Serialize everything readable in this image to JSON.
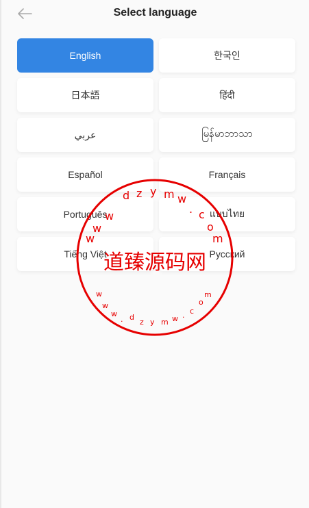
{
  "header": {
    "title": "Select language",
    "back_icon": "arrow-left-icon"
  },
  "languages": [
    {
      "label": "English",
      "selected": true
    },
    {
      "label": "한국인",
      "selected": false
    },
    {
      "label": "日本語",
      "selected": false
    },
    {
      "label": "हिंदी",
      "selected": false
    },
    {
      "label": "عربي",
      "selected": false
    },
    {
      "label": "မြန်မာဘာသာ",
      "selected": false
    },
    {
      "label": "Español",
      "selected": false
    },
    {
      "label": "Français",
      "selected": false
    },
    {
      "label": "Português",
      "selected": false
    },
    {
      "label": "แบบไทย",
      "selected": false
    },
    {
      "label": "Tiếng Việt",
      "selected": false
    },
    {
      "label": "Русский",
      "selected": false
    }
  ],
  "watermark": {
    "name": "道臻源码网",
    "url_text": "www.dzym.com",
    "color": "#e60000"
  },
  "colors": {
    "accent": "#3385e3",
    "background": "#fafafa"
  }
}
